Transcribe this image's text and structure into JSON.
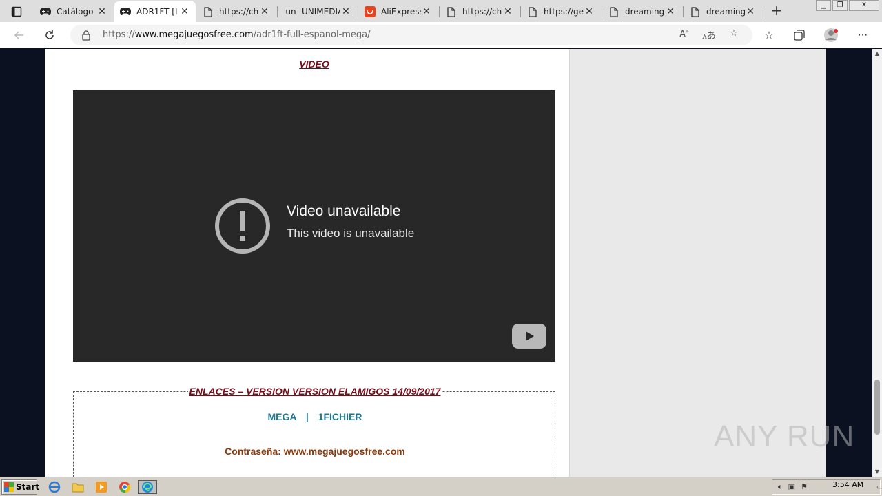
{
  "browser": {
    "tabs": [
      {
        "title": "Catálogo",
        "icon": "gamepad-icon",
        "active": false
      },
      {
        "title": "ADR1FT [I",
        "icon": "gamepad-icon",
        "active": true
      },
      {
        "title": "https://ch",
        "icon": "page-icon",
        "active": false
      },
      {
        "title": "UNIMEDIA",
        "icon": "un-icon",
        "icon_text": "un",
        "active": false
      },
      {
        "title": "AliExpress",
        "icon": "aliexpress-icon",
        "active": false
      },
      {
        "title": "https://ch",
        "icon": "page-icon",
        "active": false
      },
      {
        "title": "https://ge",
        "icon": "page-icon",
        "active": false
      },
      {
        "title": "dreaming",
        "icon": "page-icon",
        "active": false
      },
      {
        "title": "dreaming",
        "icon": "page-icon",
        "active": false
      }
    ],
    "url_prefix": "https://",
    "url_host": "www.megajuegosfree.com",
    "url_path": "/adr1ft-full-espanol-mega/",
    "window_controls": [
      "minimize",
      "restore",
      "close"
    ]
  },
  "page": {
    "video_heading": "VIDEO",
    "video": {
      "title": "Video unavailable",
      "subtitle": "This video is unavailable"
    },
    "links_heading": "ENLACES – VERSION VERSION ELAMIGOS 14/09/2017",
    "links": [
      "MEGA",
      "1FICHIER"
    ],
    "links_separator": "|",
    "password": "Contraseña: www.megajuegosfree.com",
    "watermark": "ANY RUN"
  },
  "taskbar": {
    "start_label": "Start",
    "clock": "3:54 AM"
  },
  "colors": {
    "heading_red": "#7a0d1b",
    "link_teal": "#1f7792",
    "password_brown": "#8a3b0d",
    "video_bg": "#282828"
  }
}
